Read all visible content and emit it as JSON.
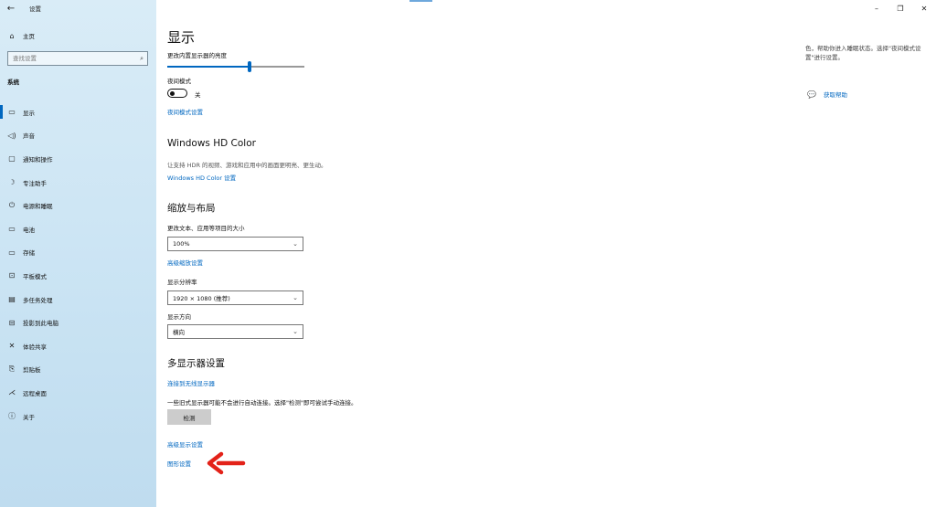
{
  "app": {
    "title": "设置"
  },
  "sidebar": {
    "home": "主页",
    "search_placeholder": "查找设置",
    "section": "系统",
    "items": [
      {
        "label": "显示",
        "icon": "monitor-icon",
        "glyph": "▭"
      },
      {
        "label": "声音",
        "icon": "speaker-icon",
        "glyph": "◁)"
      },
      {
        "label": "通知和操作",
        "icon": "notification-icon",
        "glyph": "▢"
      },
      {
        "label": "专注助手",
        "icon": "moon-icon",
        "glyph": "☽"
      },
      {
        "label": "电源和睡眠",
        "icon": "power-icon",
        "glyph": "⏻"
      },
      {
        "label": "电池",
        "icon": "battery-icon",
        "glyph": "▭"
      },
      {
        "label": "存储",
        "icon": "storage-icon",
        "glyph": "▭"
      },
      {
        "label": "平板模式",
        "icon": "tablet-icon",
        "glyph": "⊡"
      },
      {
        "label": "多任务处理",
        "icon": "multitask-icon",
        "glyph": "▤"
      },
      {
        "label": "投影到此电脑",
        "icon": "project-icon",
        "glyph": "⊟"
      },
      {
        "label": "体验共享",
        "icon": "share-icon",
        "glyph": "✕"
      },
      {
        "label": "剪贴板",
        "icon": "clipboard-icon",
        "glyph": "⎘"
      },
      {
        "label": "远程桌面",
        "icon": "remote-icon",
        "glyph": "⋌"
      },
      {
        "label": "关于",
        "icon": "info-icon",
        "glyph": "ⓘ"
      }
    ]
  },
  "main": {
    "title": "显示",
    "brightness_label": "更改内置显示器的亮度",
    "brightness_level": 60,
    "night_light_label": "夜间模式",
    "night_light_state": "关",
    "night_light_link": "夜间模式设置",
    "hdr_heading": "Windows HD Color",
    "hdr_desc": "让支持 HDR 的视频、游戏和应用中的画面更明亮、更生动。",
    "hdr_link": "Windows HD Color 设置",
    "scale_heading": "缩放与布局",
    "scale_label": "更改文本、应用等项目的大小",
    "scale_value": "100%",
    "scale_link": "高级缩放设置",
    "resolution_label": "显示分辨率",
    "resolution_value": "1920 × 1080 (推荐)",
    "orientation_label": "显示方向",
    "orientation_value": "横向",
    "multi_heading": "多显示器设置",
    "wireless_link": "连接到无线显示器",
    "detect_desc": "一些旧式显示器可能不会进行自动连接。选择\"检测\"即可尝试手动连接。",
    "detect_button": "检测",
    "advanced_link": "高级显示设置",
    "graphics_link": "图形设置"
  },
  "right_panel": {
    "text": "色，帮助你进入睡眠状态。选择\"夜间模式设置\"进行设置。",
    "help_link": "获取帮助"
  },
  "window_controls": {
    "minimize": "–",
    "restore": "❐",
    "close": "✕"
  },
  "colors": {
    "accent": "#0067c0",
    "annotation_arrow": "#e32219"
  }
}
